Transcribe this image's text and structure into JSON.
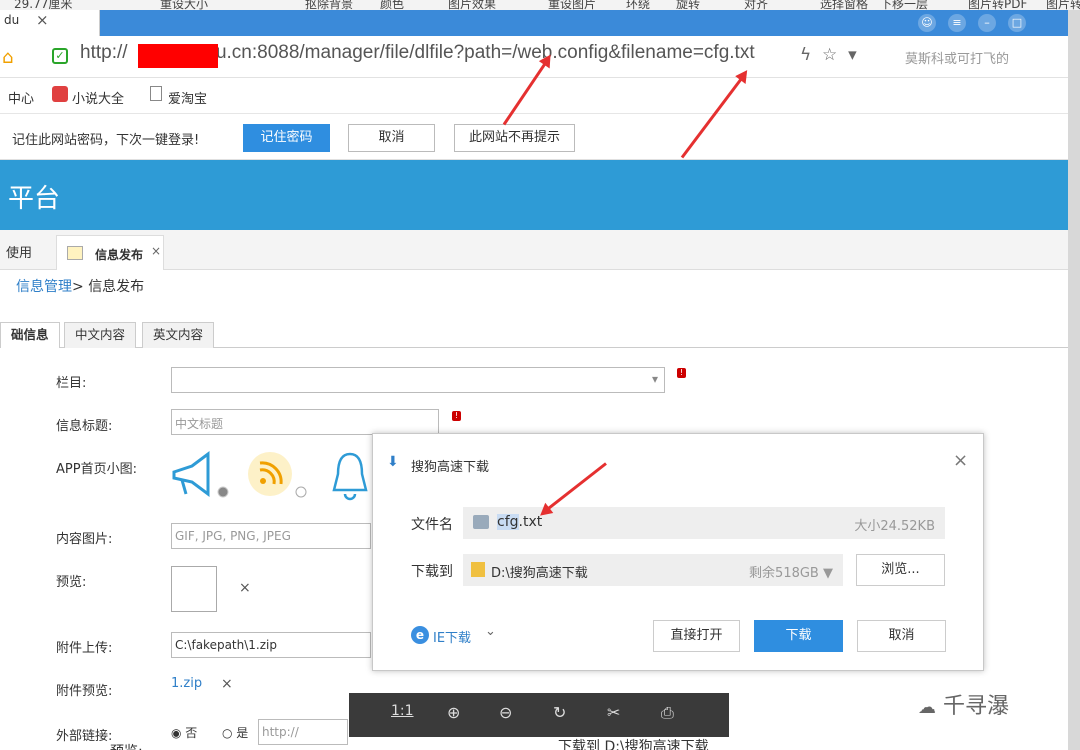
{
  "image_toolbar": {
    "zoom_text": "29.77厘米",
    "items": [
      "重设大小",
      "抠除背景",
      "颜色",
      "图片效果",
      "重设图片",
      "环绕",
      "旋转",
      "对齐",
      "选择窗格",
      "下移一层",
      "图片转PDF",
      "图片转"
    ]
  },
  "browser": {
    "tab_title": "du",
    "tab_close": "×",
    "url_prefix": "http://",
    "url_host_tail": ".edu.cn:8088",
    "url_path": "/manager/file/dlfile?path=/web.config&filename=cfg.txt",
    "search_hint": "莫斯科或可打飞的",
    "bookmarks": [
      "中心",
      "小说大全",
      "爱淘宝"
    ]
  },
  "password_bar": {
    "message": "记住此网站密码，下次一键登录!",
    "save": "记住密码",
    "cancel": "取消",
    "never": "此网站不再提示"
  },
  "site": {
    "banner_title": "平台",
    "tabs": [
      "使用",
      "信息发布"
    ],
    "tab_close": "×",
    "breadcrumb_link": "信息管理",
    "breadcrumb_sep": ">",
    "breadcrumb_current": "信息发布",
    "form_tabs": [
      "础信息",
      "中文内容",
      "英文内容"
    ]
  },
  "form": {
    "column_label": "栏目:",
    "title_label": "信息标题:",
    "title_placeholder": "中文标题",
    "app_icon_label": "APP首页小图:",
    "content_image_label": "内容图片:",
    "content_image_placeholder": "GIF, JPG, PNG, JPEG",
    "preview_label": "预览:",
    "attach_upload_label": "附件上传:",
    "attach_upload_value": "C:\\fakepath\\1.zip",
    "attach_preview_label": "附件预览:",
    "attach_preview_value": "1.zip",
    "external_link_label": "外部链接:",
    "radio_no": "否",
    "radio_yes": "是",
    "link_placeholder": "http://",
    "delete_mark": "×"
  },
  "download_dialog": {
    "title": "搜狗高速下载",
    "filename_label": "文件名",
    "filename_highlight": "cfg",
    "filename_rest": ".txt",
    "size": "大小24.52KB",
    "dest_label": "下载到",
    "dest_path": "D:\\搜狗高速下载",
    "free_space": "剩余518GB",
    "browse": "浏览...",
    "ie_download": "IE下载",
    "open_direct": "直接打开",
    "download": "下载",
    "cancel": "取消",
    "close": "×"
  },
  "viewer_toolbar": {
    "actual_size": "1:1"
  },
  "watermark": "千寻瀑",
  "bottom_partial": {
    "left": "预览:",
    "right": "下载到  D:\\搜狗高速下载"
  },
  "colors": {
    "browser_blue": "#3b8ad9",
    "banner_blue": "#2e9bd6",
    "button_blue": "#2f8ee0",
    "annotation_red": "#e53030"
  }
}
